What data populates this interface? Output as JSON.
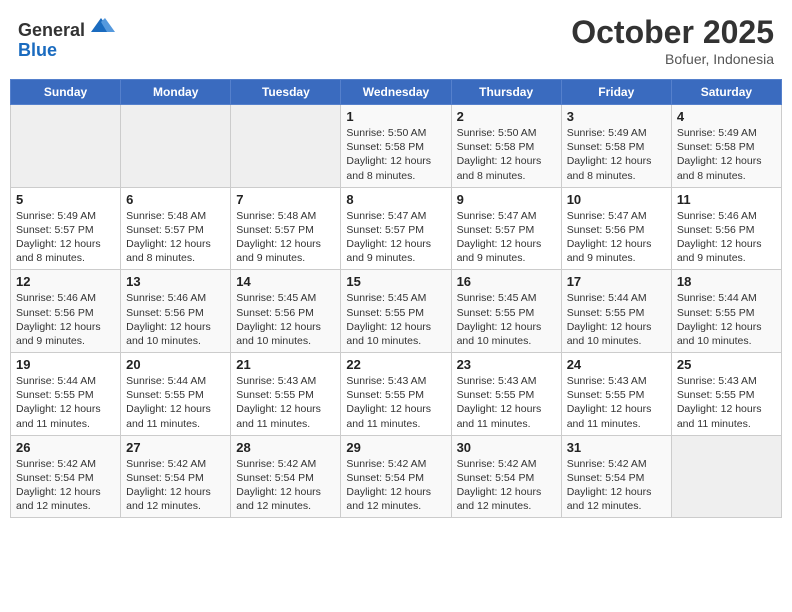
{
  "header": {
    "logo_general": "General",
    "logo_blue": "Blue",
    "month_title": "October 2025",
    "location": "Bofuer, Indonesia"
  },
  "weekdays": [
    "Sunday",
    "Monday",
    "Tuesday",
    "Wednesday",
    "Thursday",
    "Friday",
    "Saturday"
  ],
  "weeks": [
    [
      {
        "day": "",
        "info": ""
      },
      {
        "day": "",
        "info": ""
      },
      {
        "day": "",
        "info": ""
      },
      {
        "day": "1",
        "info": "Sunrise: 5:50 AM\nSunset: 5:58 PM\nDaylight: 12 hours\nand 8 minutes."
      },
      {
        "day": "2",
        "info": "Sunrise: 5:50 AM\nSunset: 5:58 PM\nDaylight: 12 hours\nand 8 minutes."
      },
      {
        "day": "3",
        "info": "Sunrise: 5:49 AM\nSunset: 5:58 PM\nDaylight: 12 hours\nand 8 minutes."
      },
      {
        "day": "4",
        "info": "Sunrise: 5:49 AM\nSunset: 5:58 PM\nDaylight: 12 hours\nand 8 minutes."
      }
    ],
    [
      {
        "day": "5",
        "info": "Sunrise: 5:49 AM\nSunset: 5:57 PM\nDaylight: 12 hours\nand 8 minutes."
      },
      {
        "day": "6",
        "info": "Sunrise: 5:48 AM\nSunset: 5:57 PM\nDaylight: 12 hours\nand 8 minutes."
      },
      {
        "day": "7",
        "info": "Sunrise: 5:48 AM\nSunset: 5:57 PM\nDaylight: 12 hours\nand 9 minutes."
      },
      {
        "day": "8",
        "info": "Sunrise: 5:47 AM\nSunset: 5:57 PM\nDaylight: 12 hours\nand 9 minutes."
      },
      {
        "day": "9",
        "info": "Sunrise: 5:47 AM\nSunset: 5:57 PM\nDaylight: 12 hours\nand 9 minutes."
      },
      {
        "day": "10",
        "info": "Sunrise: 5:47 AM\nSunset: 5:56 PM\nDaylight: 12 hours\nand 9 minutes."
      },
      {
        "day": "11",
        "info": "Sunrise: 5:46 AM\nSunset: 5:56 PM\nDaylight: 12 hours\nand 9 minutes."
      }
    ],
    [
      {
        "day": "12",
        "info": "Sunrise: 5:46 AM\nSunset: 5:56 PM\nDaylight: 12 hours\nand 9 minutes."
      },
      {
        "day": "13",
        "info": "Sunrise: 5:46 AM\nSunset: 5:56 PM\nDaylight: 12 hours\nand 10 minutes."
      },
      {
        "day": "14",
        "info": "Sunrise: 5:45 AM\nSunset: 5:56 PM\nDaylight: 12 hours\nand 10 minutes."
      },
      {
        "day": "15",
        "info": "Sunrise: 5:45 AM\nSunset: 5:55 PM\nDaylight: 12 hours\nand 10 minutes."
      },
      {
        "day": "16",
        "info": "Sunrise: 5:45 AM\nSunset: 5:55 PM\nDaylight: 12 hours\nand 10 minutes."
      },
      {
        "day": "17",
        "info": "Sunrise: 5:44 AM\nSunset: 5:55 PM\nDaylight: 12 hours\nand 10 minutes."
      },
      {
        "day": "18",
        "info": "Sunrise: 5:44 AM\nSunset: 5:55 PM\nDaylight: 12 hours\nand 10 minutes."
      }
    ],
    [
      {
        "day": "19",
        "info": "Sunrise: 5:44 AM\nSunset: 5:55 PM\nDaylight: 12 hours\nand 11 minutes."
      },
      {
        "day": "20",
        "info": "Sunrise: 5:44 AM\nSunset: 5:55 PM\nDaylight: 12 hours\nand 11 minutes."
      },
      {
        "day": "21",
        "info": "Sunrise: 5:43 AM\nSunset: 5:55 PM\nDaylight: 12 hours\nand 11 minutes."
      },
      {
        "day": "22",
        "info": "Sunrise: 5:43 AM\nSunset: 5:55 PM\nDaylight: 12 hours\nand 11 minutes."
      },
      {
        "day": "23",
        "info": "Sunrise: 5:43 AM\nSunset: 5:55 PM\nDaylight: 12 hours\nand 11 minutes."
      },
      {
        "day": "24",
        "info": "Sunrise: 5:43 AM\nSunset: 5:55 PM\nDaylight: 12 hours\nand 11 minutes."
      },
      {
        "day": "25",
        "info": "Sunrise: 5:43 AM\nSunset: 5:55 PM\nDaylight: 12 hours\nand 11 minutes."
      }
    ],
    [
      {
        "day": "26",
        "info": "Sunrise: 5:42 AM\nSunset: 5:54 PM\nDaylight: 12 hours\nand 12 minutes."
      },
      {
        "day": "27",
        "info": "Sunrise: 5:42 AM\nSunset: 5:54 PM\nDaylight: 12 hours\nand 12 minutes."
      },
      {
        "day": "28",
        "info": "Sunrise: 5:42 AM\nSunset: 5:54 PM\nDaylight: 12 hours\nand 12 minutes."
      },
      {
        "day": "29",
        "info": "Sunrise: 5:42 AM\nSunset: 5:54 PM\nDaylight: 12 hours\nand 12 minutes."
      },
      {
        "day": "30",
        "info": "Sunrise: 5:42 AM\nSunset: 5:54 PM\nDaylight: 12 hours\nand 12 minutes."
      },
      {
        "day": "31",
        "info": "Sunrise: 5:42 AM\nSunset: 5:54 PM\nDaylight: 12 hours\nand 12 minutes."
      },
      {
        "day": "",
        "info": ""
      }
    ]
  ]
}
